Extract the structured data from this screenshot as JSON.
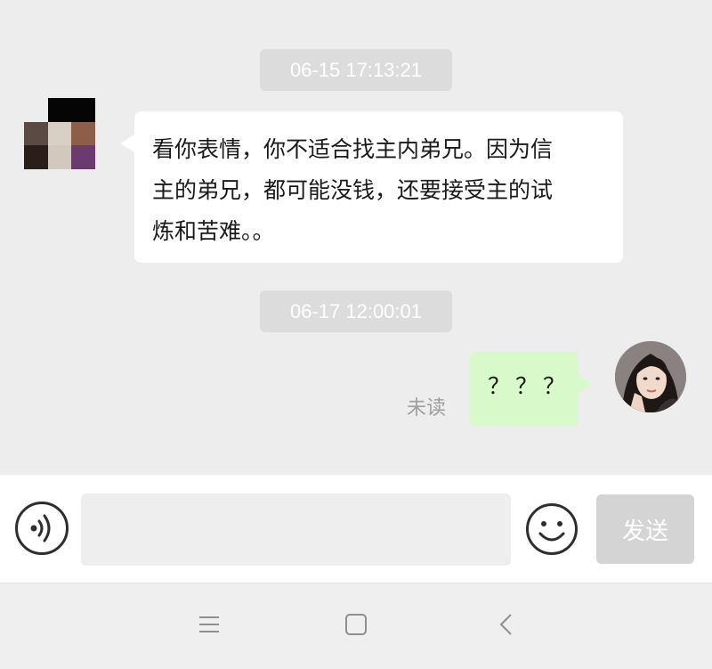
{
  "chat": {
    "messages": [
      {
        "timestamp": "06-15 17:13:21",
        "sender": "other",
        "lines": [
          "看你表情，你不适合找主内弟兄。因为信",
          "主的弟兄，都可能没钱，还要接受主的试",
          "炼和苦难。。"
        ]
      },
      {
        "timestamp": "06-17 12:00:01",
        "sender": "self",
        "text": "？？？",
        "status": "未读"
      }
    ]
  },
  "avatars": {
    "other": {
      "icon": "pixelated-avatar",
      "colors": [
        "#ededed",
        "#050505",
        "#050505",
        "#5b4a43",
        "#d9cfc5",
        "#8e5f48",
        "#2a1e18",
        "#d3c8bd",
        "#6b3a6f"
      ]
    },
    "self": {
      "icon": "user-photo-avatar"
    }
  },
  "input_bar": {
    "voice_icon": "voice-icon",
    "input_placeholder": "",
    "emoji_icon": "smiley-icon",
    "send_label": "发送"
  },
  "nav_bar": {
    "icons": [
      "menu-icon",
      "home-icon",
      "back-icon"
    ]
  },
  "colors": {
    "chat_bg": "#ededed",
    "self_bubble": "#d8f9c9",
    "other_bubble": "#ffffff",
    "timestamp_bg": "#dcdcdc",
    "send_disabled": "#d4d4d4"
  }
}
